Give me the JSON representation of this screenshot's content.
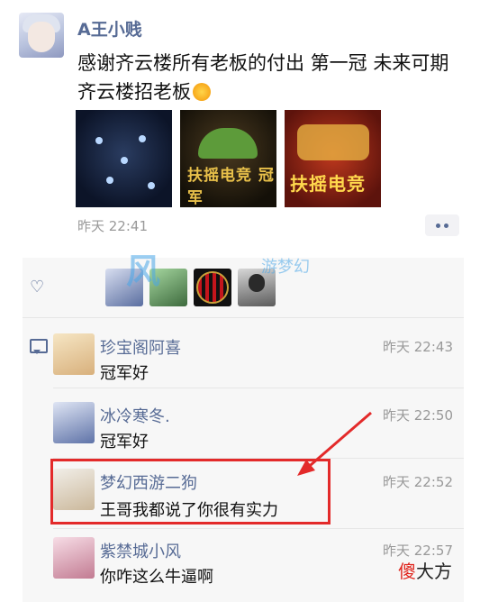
{
  "post": {
    "author": "A王小贱",
    "text": "感谢齐云楼所有老板的付出 第一冠 未来可期 齐云楼招老板",
    "emoji": "sun-emoji",
    "time": "昨天 22:41",
    "images": [
      "game-map-screenshot",
      "扶摇电竞 冠军",
      "扶摇电竞"
    ]
  },
  "watermark": {
    "text": "风",
    "sub": "游梦幻"
  },
  "likes": {
    "icon": "heart-icon",
    "avatars": [
      "anime-avatar",
      "green-anime-avatar",
      "ac-milan-avatar",
      "photo-avatar"
    ]
  },
  "comments": [
    {
      "name": "珍宝阁阿喜",
      "time": "昨天 22:43",
      "text": "冠军好"
    },
    {
      "name": "冰冷寒冬.",
      "time": "昨天 22:50",
      "text": "冠军好"
    },
    {
      "name": "梦幻西游二狗",
      "time": "昨天 22:52",
      "text": "王哥我都说了你很有实力"
    },
    {
      "name": "紫禁城小风",
      "time": "昨天 22:57",
      "text": "你咋这么牛逼啊"
    }
  ],
  "brand": {
    "highlight": "傻",
    "rest": "大方"
  },
  "colors": {
    "link": "#576b95",
    "annotation": "#e32a2a"
  }
}
